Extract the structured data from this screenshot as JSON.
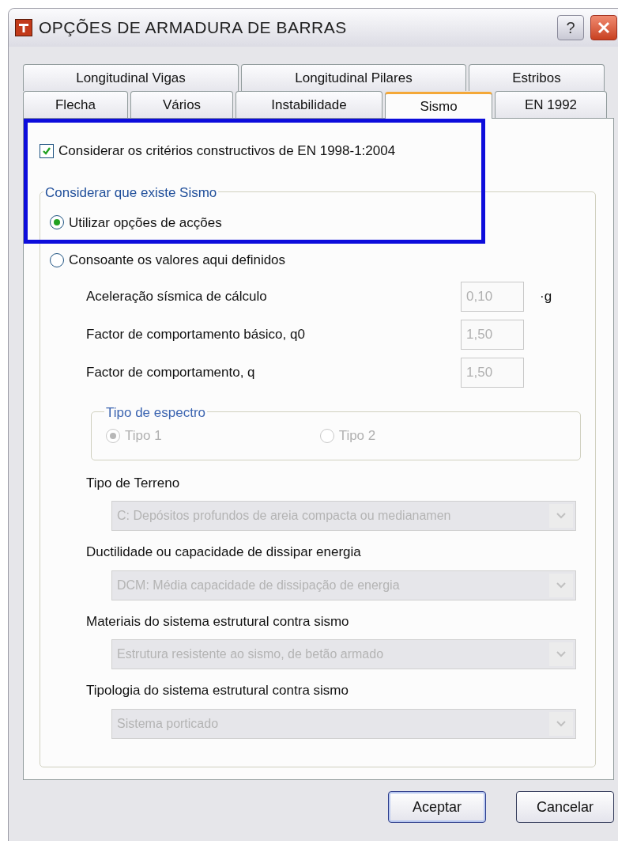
{
  "window": {
    "title": "OPÇÕES DE ARMADURA DE BARRAS",
    "help_label": "?"
  },
  "tabs": [
    [
      {
        "label": "Longitudinal Vigas",
        "selected": false
      },
      {
        "label": "Longitudinal Pilares",
        "selected": false
      },
      {
        "label": "Estribos",
        "selected": false
      }
    ],
    [
      {
        "label": "Flecha",
        "selected": false
      },
      {
        "label": "Vários",
        "selected": false
      },
      {
        "label": "Instabilidade",
        "selected": false
      },
      {
        "label": "Sismo",
        "selected": true
      },
      {
        "label": "EN 1992",
        "selected": false
      }
    ]
  ],
  "checkbox": {
    "label": "Considerar os critérios constructivos de EN 1998-1:2004",
    "checked": true
  },
  "seismic_group": {
    "title": "Considerar que existe Sismo",
    "options": [
      {
        "label": "Utilizar opções de acções",
        "selected": true
      },
      {
        "label": "Consoante os valores aqui definidos",
        "selected": false
      }
    ]
  },
  "fields": [
    {
      "label": "Aceleração sísmica de cálculo",
      "value": "0,10",
      "unit": "·g",
      "disabled": true
    },
    {
      "label": "Factor de comportamento básico, q0",
      "value": "1,50",
      "disabled": true
    },
    {
      "label": "Factor de comportamento, q",
      "value": "1,50",
      "disabled": true
    }
  ],
  "spectrum_group": {
    "title": "Tipo de espectro",
    "disabled": true,
    "options": [
      {
        "label": "Tipo 1",
        "selected": true
      },
      {
        "label": "Tipo 2",
        "selected": false
      }
    ]
  },
  "dropdowns": [
    {
      "label": "Tipo de Terreno",
      "value": "C: Depósitos profundos de areia compacta ou medianamen",
      "disabled": true
    },
    {
      "label": "Ductilidade ou capacidade de dissipar energia",
      "value": "DCM: Média capacidade de dissipação de energia",
      "disabled": true
    },
    {
      "label": "Materiais do sistema estrutural contra sismo",
      "value": "Estrutura resistente ao sismo, de betão armado",
      "disabled": true
    },
    {
      "label": "Tipologia do sistema estrutural contra sismo",
      "value": "Sistema porticado",
      "disabled": true
    }
  ],
  "buttons": [
    {
      "label": "Aceptar",
      "kind": "default"
    },
    {
      "label": "Cancelar",
      "kind": "normal"
    }
  ]
}
